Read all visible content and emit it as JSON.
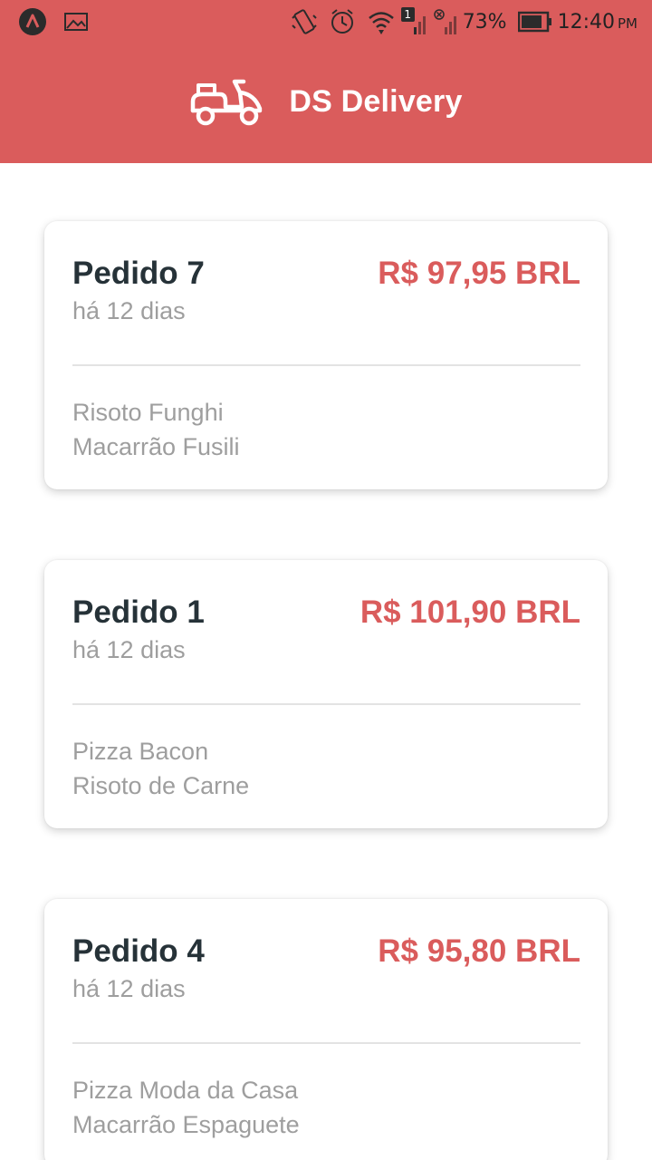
{
  "status_bar": {
    "battery": "73%",
    "time": "12:40",
    "ampm": "PM",
    "notification_count": "1",
    "icons": [
      "app-logo-icon",
      "gallery-icon",
      "vibrate-icon",
      "alarm-icon",
      "wifi-icon",
      "signal-icon",
      "no-signal-icon",
      "battery-icon"
    ]
  },
  "header": {
    "title": "DS Delivery",
    "logo_icon": "scooter-icon"
  },
  "colors": {
    "brand": "#da5c5c",
    "title_text": "#263238",
    "muted_text": "#9e9e9e"
  },
  "orders": [
    {
      "title": "Pedido 7",
      "time": "há 12 dias",
      "price": "R$ 97,95 BRL",
      "items": [
        "Risoto Funghi",
        "Macarrão Fusili"
      ]
    },
    {
      "title": "Pedido 1",
      "time": "há 12 dias",
      "price": "R$ 101,90 BRL",
      "items": [
        "Pizza Bacon",
        "Risoto de Carne"
      ]
    },
    {
      "title": "Pedido 4",
      "time": "há 12 dias",
      "price": "R$ 95,80 BRL",
      "items": [
        "Pizza Moda da Casa",
        "Macarrão Espaguete"
      ]
    }
  ]
}
